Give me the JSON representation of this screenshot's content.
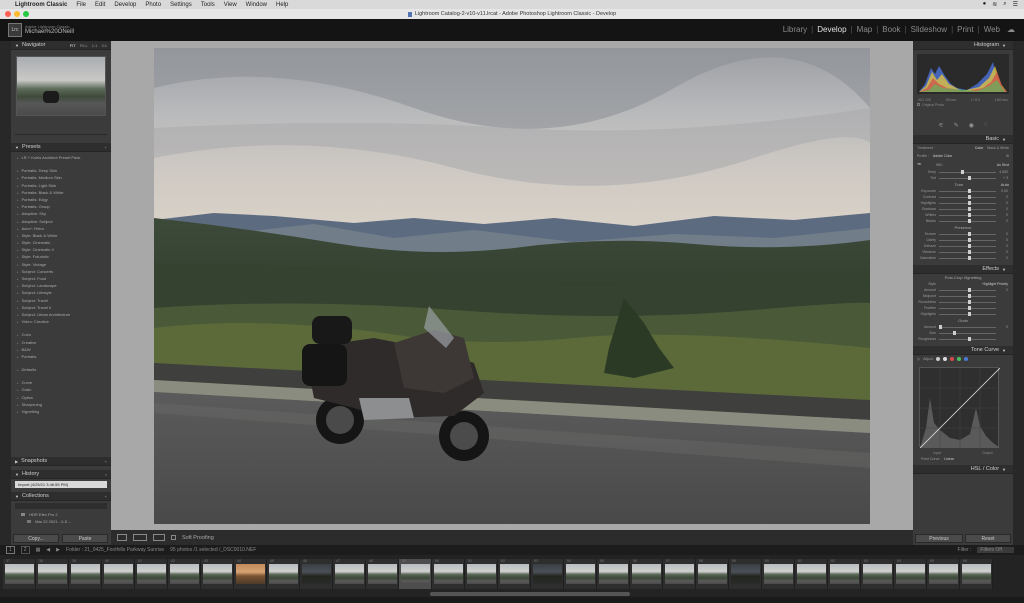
{
  "menubar": {
    "app": "Lightroom Classic",
    "items": [
      "File",
      "Edit",
      "Develop",
      "Photo",
      "Settings",
      "Tools",
      "View",
      "Window",
      "Help"
    ]
  },
  "window": {
    "title": "Lightroom Catalog-2-v10-v11.lrcat - Adobe Photoshop Lightroom Classic - Develop"
  },
  "identity": {
    "logo": "Lrc",
    "line1": "Adobe Lightroom Classic",
    "user": "Michael%20ONeill"
  },
  "modules": [
    "Library",
    "Develop",
    "Map",
    "Book",
    "Slideshow",
    "Print",
    "Web"
  ],
  "active_module": "Develop",
  "left": {
    "navigator": {
      "title": "Navigator",
      "zoom_fit": "FIT",
      "zoom_fill": "FILL",
      "zoom_1": "1:1",
      "zoom_other": "3:1"
    },
    "presets": {
      "title": "Presets",
      "items": [
        "LR + Kohls Architect Preset Pack",
        "",
        "Portraits: Deep Skin",
        "Portraits: Medium Skin",
        "Portraits: Light Skin",
        "Portraits: Black & White",
        "Portraits: Edgy",
        "Portraits: Group",
        "Adaptive: Sky",
        "Adaptive: Subject",
        "Auto+: Retro",
        "Style: Black & White",
        "Style: Cinematic",
        "Style: Cinematic II",
        "Style: Futuristic",
        "Style: Vintage",
        "Subject: Concerts",
        "Subject: Food",
        "Subject: Landscape",
        "Subject: Lifestyle",
        "Subject: Travel",
        "Subject: Travel II",
        "Subject: Urban Architecture",
        "Video: Creative",
        "",
        "Color",
        "Creative",
        "B&W",
        "Portraits",
        "",
        "Defaults",
        "",
        "Curve",
        "Grain",
        "Optics",
        "Sharpening",
        "Vignetting"
      ]
    },
    "snapshots": "Snapshots",
    "history": {
      "title": "History",
      "item": "Import (4/25/21 3:46:55 PM)"
    },
    "collections": {
      "title": "Collections",
      "items": [
        "HDR Efex Pro 2",
        "Mar 22 2021 - 0-5 ..."
      ]
    },
    "copy_btn": "Copy...",
    "paste_btn": "Paste"
  },
  "toolbar": {
    "soft_proofing": "Soft Proofing"
  },
  "filmstrip_bar": {
    "page1": "1",
    "page2": "2",
    "folder": "Folder : 21_0425_Foothills Parkway Sunrise",
    "count": "95 photos /1 selected /_DSC0010.NEF",
    "filter_label": "Filter :",
    "filter_value": "Filters Off"
  },
  "filmstrip": {
    "numbers": [
      "37",
      "38",
      "39",
      "40",
      "41",
      "42",
      "43",
      "44",
      "45",
      "46",
      "47",
      "48",
      "49",
      "50",
      "51",
      "52",
      "53",
      "54",
      "55",
      "56",
      "57",
      "58",
      "59",
      "60",
      "61",
      "62",
      "63",
      "64",
      "65",
      "66"
    ],
    "selected_index": 12
  },
  "right": {
    "histogram": {
      "title": "Histogram",
      "iso": "ISO 100",
      "focal": "35 mm",
      "aperture": "f / 8.0",
      "shutter": "1/60 sec",
      "original_photo": "Original Photo"
    },
    "basic": {
      "title": "Basic",
      "treatment_label": "Treatment :",
      "treatment_color": "Color",
      "treatment_bw": "Black & White",
      "profile_label": "Profile :",
      "profile_value": "Adobe Color",
      "wb_label": "WB :",
      "wb_value": "As Shot",
      "tone_label": "Tone",
      "tone_auto": "Auto",
      "presence_label": "Presence",
      "sliders_wb": [
        {
          "label": "Temp",
          "value": "4,850"
        },
        {
          "label": "Tint",
          "value": "+ 3"
        }
      ],
      "sliders_tone": [
        {
          "label": "Exposure",
          "value": "0.00"
        },
        {
          "label": "Contrast",
          "value": "0"
        },
        {
          "label": "Highlights",
          "value": "0"
        },
        {
          "label": "Shadows",
          "value": "0"
        },
        {
          "label": "Whites",
          "value": "0"
        },
        {
          "label": "Blacks",
          "value": "0"
        }
      ],
      "sliders_presence": [
        {
          "label": "Texture",
          "value": "0"
        },
        {
          "label": "Clarity",
          "value": "0"
        },
        {
          "label": "Dehaze",
          "value": "0"
        },
        {
          "label": "Vibrance",
          "value": "0"
        },
        {
          "label": "Saturation",
          "value": "0"
        }
      ]
    },
    "effects": {
      "title": "Effects",
      "vignette_label": "Post-Crop Vignetting",
      "style_label": "Style",
      "style_value": "Highlight Priority",
      "sliders_vig": [
        {
          "label": "Amount",
          "value": "0"
        },
        {
          "label": "Midpoint",
          "value": ""
        },
        {
          "label": "Roundness",
          "value": ""
        },
        {
          "label": "Feather",
          "value": ""
        },
        {
          "label": "Highlights",
          "value": ""
        }
      ],
      "grain_label": "Grain",
      "sliders_grain": [
        {
          "label": "Amount",
          "value": "0"
        },
        {
          "label": "Size",
          "value": ""
        },
        {
          "label": "Roughness",
          "value": ""
        }
      ]
    },
    "tone_curve": {
      "title": "Tone Curve",
      "adjust": "Adjust",
      "input": "Input",
      "output": "Output",
      "point_curve_label": "Point Curve :",
      "point_curve_value": "Linear"
    },
    "hsl": "HSL / Color",
    "previous_btn": "Previous",
    "reset_btn": "Reset"
  }
}
